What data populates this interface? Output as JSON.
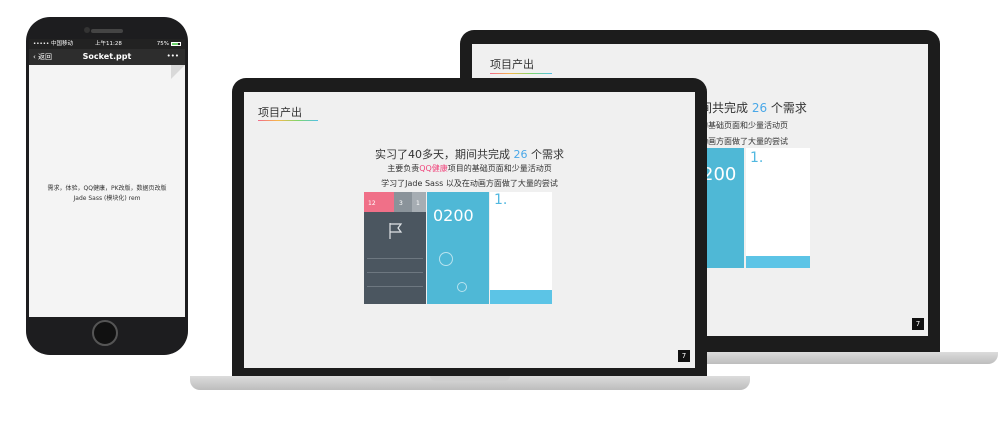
{
  "phone": {
    "status": {
      "carrier": "••••• 中国移动",
      "time": "上午11:28",
      "battery": "75%"
    },
    "nav": {
      "back": "返回",
      "title": "Socket.ppt",
      "more": "•••"
    },
    "doc_text": [
      "需求，体验，QQ健康，PK改版，数据页改版",
      "Jade Sass (模块化) rem"
    ]
  },
  "laptop_front": {
    "slide": {
      "title": "项目产出",
      "headline_prefix": "实习了40多天，期间共完成 ",
      "headline_number": "26",
      "headline_suffix": " 个需求",
      "line2_prefix": "主要负责",
      "line2_highlight": "QQ健康",
      "line2_suffix": "项目的基础页面和少量活动页",
      "line3": "学习了Jade Sass 以及在动画方面做了大量的尝试",
      "page_number": "7",
      "panel_center_number": "0200",
      "panel_right_number": "1.",
      "panel_left_tabs": [
        "12",
        "3",
        "1"
      ]
    }
  },
  "laptop_back": {
    "slide": {
      "title": "项目产出",
      "headline": "间共完成 ",
      "headline_number": "26",
      "headline_suffix": " 个需求",
      "line2": "的基础页面和少量活动页",
      "line3": "动画方面做了大量的尝试",
      "page_number": "7",
      "panel_center_number": "200",
      "panel_right_number": "1."
    }
  },
  "colors": {
    "accent_blue": "#4aa8e8",
    "accent_pink": "#f0447b",
    "panel_cyan": "#4fb8d6",
    "panel_slate": "#4b5660"
  }
}
